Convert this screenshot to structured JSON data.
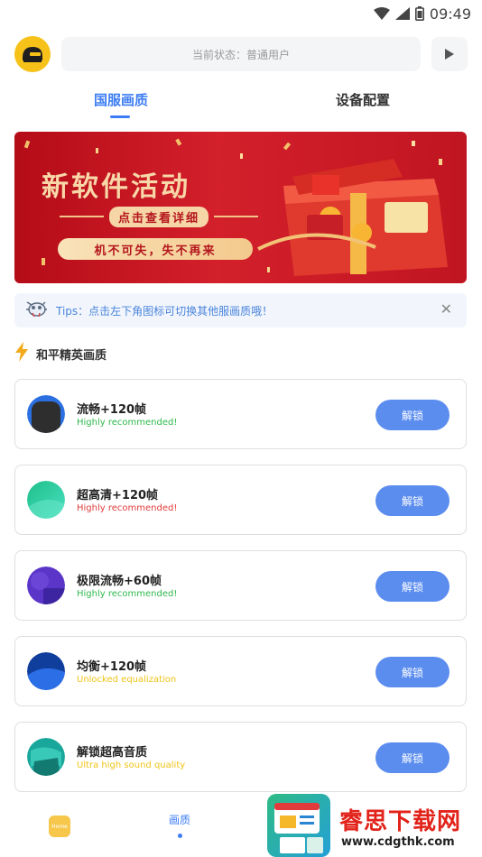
{
  "status_bar": {
    "time": "09:49",
    "icons": [
      "wifi-icon",
      "signal-icon",
      "battery-icon"
    ]
  },
  "header": {
    "status_text": "当前状态：普通用户"
  },
  "tabs": [
    {
      "label": "国服画质",
      "active": true
    },
    {
      "label": "设备配置",
      "active": false
    }
  ],
  "banner": {
    "title": "新软件活动",
    "subtitle": "点击查看详细",
    "slogan": "机不可失，失不再来"
  },
  "tips": {
    "text": "Tips：点击左下角图标可切换其他服画质哦！"
  },
  "section": {
    "title": "和平精英画质"
  },
  "cards": [
    {
      "name": "流畅+120帧",
      "desc": "Highly recommended!",
      "desc_color": "#2fb84c",
      "button": "解锁",
      "icon_color": "#2b5fd9"
    },
    {
      "name": "超高清+120帧",
      "desc": "Highly recommended!",
      "desc_color": "#e23b3b",
      "button": "解锁",
      "icon_color": "#2ccf9e"
    },
    {
      "name": "极限流畅+60帧",
      "desc": "Highly recommended!",
      "desc_color": "#2fb84c",
      "button": "解锁",
      "icon_color": "#6a3fd0"
    },
    {
      "name": "均衡+120帧",
      "desc": "Unlocked equalization",
      "desc_color": "#f0c419",
      "button": "解锁",
      "icon_color": "#1a56c4"
    },
    {
      "name": "解锁超高音质",
      "desc": "Ultra high sound quality",
      "desc_color": "#f0c419",
      "button": "解锁",
      "icon_color": "#1fb3a8"
    }
  ],
  "bottom_nav": {
    "home_icon_text": "Home",
    "quality_label": "画质"
  },
  "watermark": {
    "title": "睿思下载网",
    "url": "www.cdgthk.com"
  },
  "colors": {
    "accent": "#3d7df3",
    "button": "#5b8def",
    "banner_red": "#c8141f"
  }
}
